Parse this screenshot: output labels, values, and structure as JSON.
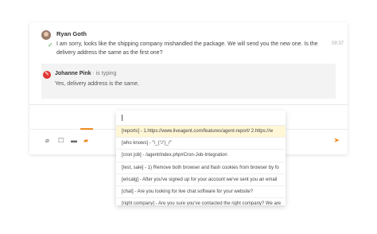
{
  "conversation": {
    "agent_name": "Ryan Goth",
    "agent_message": "I am sorry, looks like the shipping company mishandled the package. We will send you the new one. Is the delivery address the same as the first one?",
    "agent_time": "09:37",
    "customer_name": "Johanne Pink",
    "customer_status": "· is typing",
    "customer_typing_text": "Yes, delivery address is the same."
  },
  "toolbar": {
    "icons": [
      "attachment-icon",
      "chat-icon",
      "folder-icon",
      "canned-response-icon"
    ],
    "send_icon": "send-icon"
  },
  "dropdown": {
    "items": [
      "[reports] - 1.https://www.liveagent.com/features/agent-report/ 2.https://w",
      "[who knows] - \"\\_(ツ)_/\"",
      "[cron job] - /agent/index.php#Cron-Job-Integration",
      "[test, sale] - 1) Remove both browser and flash cookies from browser by fo",
      "[ericalg] - After you've signed up for your account we've sent you an email",
      "[chat] - Are you looking for live chat software for your website?",
      "[right company] - Are you sure you've contacted the right company? We are"
    ],
    "selected_index": 0
  },
  "colors": {
    "accent": "#f08a24",
    "check": "#3aa843",
    "customer_icon": "#e03333",
    "selected_bg": "#fff6d6"
  }
}
